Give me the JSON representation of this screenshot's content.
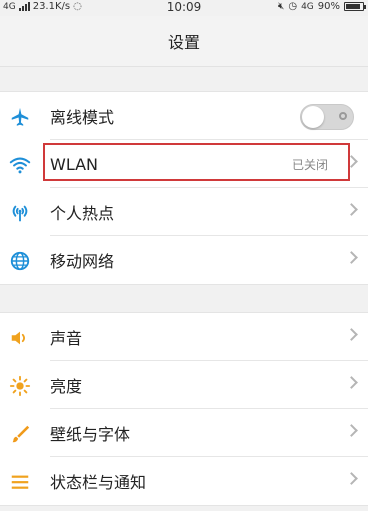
{
  "statusbar": {
    "network": "4G",
    "speed": "23.1K/s",
    "time": "10:09",
    "network2": "4G",
    "battery": "90%"
  },
  "title": "设置",
  "groups": [
    {
      "items": [
        {
          "label": "离线模式",
          "icon": "airplane-icon",
          "control": "toggle",
          "toggle_on": false
        },
        {
          "label": "WLAN",
          "icon": "wifi-icon",
          "value": "已关闭"
        },
        {
          "label": "个人热点",
          "icon": "hotspot-icon"
        },
        {
          "label": "移动网络",
          "icon": "globe-icon"
        }
      ]
    },
    {
      "items": [
        {
          "label": "声音",
          "icon": "speaker-icon"
        },
        {
          "label": "亮度",
          "icon": "brightness-icon"
        },
        {
          "label": "壁纸与字体",
          "icon": "brush-icon"
        },
        {
          "label": "状态栏与通知",
          "icon": "menu-icon"
        }
      ]
    }
  ],
  "colors": {
    "accent_blue": "#1e8fd8",
    "sound_orange": "#f0a21e",
    "brush_orange": "#f09a1a",
    "highlight_red": "#d0393a"
  }
}
